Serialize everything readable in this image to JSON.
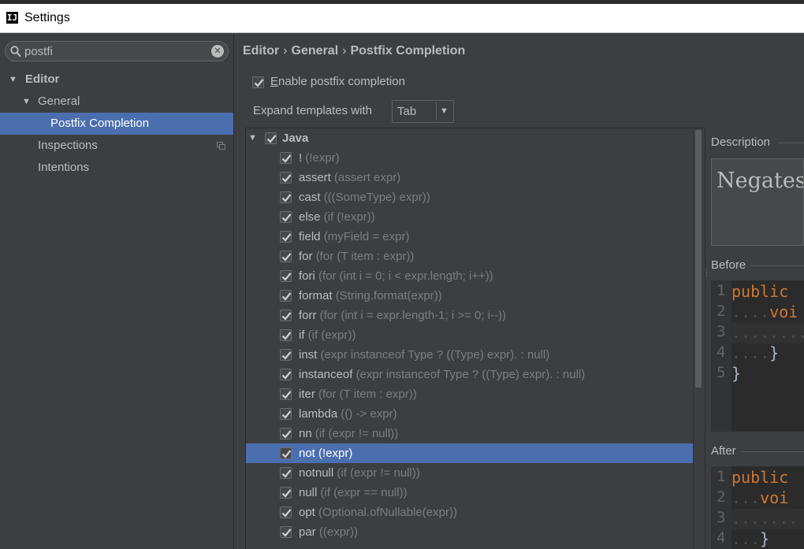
{
  "window": {
    "title": "Settings",
    "icon": "intellij-icon"
  },
  "search": {
    "value": "postfi"
  },
  "tree": [
    {
      "label": "Editor",
      "bold": true,
      "expanded": true
    },
    {
      "label": "General",
      "expanded": true
    },
    {
      "label": "Postfix Completion",
      "selected": true
    },
    {
      "label": "Inspections",
      "has_copy_icon": true
    },
    {
      "label": "Intentions"
    }
  ],
  "breadcrumb": [
    "Editor",
    "General",
    "Postfix Completion"
  ],
  "enable": {
    "label_mnemonic": "E",
    "label_rest": "nable postfix completion",
    "checked": true
  },
  "expand": {
    "label": "Expand templates with",
    "value": "Tab"
  },
  "templates": {
    "group": "Java",
    "items": [
      {
        "key": "!",
        "example": "(!expr)"
      },
      {
        "key": "assert",
        "example": "(assert expr)"
      },
      {
        "key": "cast",
        "example": "(((SomeType) expr))"
      },
      {
        "key": "else",
        "example": "(if (!expr))"
      },
      {
        "key": "field",
        "example": "(myField = expr)"
      },
      {
        "key": "for",
        "example": "(for (T item : expr))"
      },
      {
        "key": "fori",
        "example": "(for (int i = 0; i < expr.length; i++))"
      },
      {
        "key": "format",
        "example": "(String.format(expr))"
      },
      {
        "key": "forr",
        "example": "(for (int i = expr.length-1; i >= 0; i--))"
      },
      {
        "key": "if",
        "example": "(if (expr))"
      },
      {
        "key": "inst",
        "example": "(expr instanceof Type ? ((Type) expr). : null)"
      },
      {
        "key": "instanceof",
        "example": "(expr instanceof Type ? ((Type) expr). : null)"
      },
      {
        "key": "iter",
        "example": "(for (T item : expr))"
      },
      {
        "key": "lambda",
        "example": "(() -> expr)"
      },
      {
        "key": "nn",
        "example": "(if (expr != null))"
      },
      {
        "key": "not",
        "example": "(!expr)",
        "selected": true
      },
      {
        "key": "notnull",
        "example": "(if (expr != null))"
      },
      {
        "key": "null",
        "example": "(if (expr == null))"
      },
      {
        "key": "opt",
        "example": "(Optional.ofNullable(expr))"
      },
      {
        "key": "par",
        "example": "((expr))"
      }
    ]
  },
  "description": {
    "title": "Description",
    "text": "Negates be"
  },
  "before": {
    "title": "Before",
    "lines": [
      {
        "n": "1",
        "dots": "",
        "kw": "public",
        "text": ""
      },
      {
        "n": "2",
        "dots": "....",
        "kw": "voi",
        "text": ""
      },
      {
        "n": "3",
        "dots": "........",
        "kw": "",
        "text": ""
      },
      {
        "n": "4",
        "dots": "....",
        "kw": "",
        "text": "}"
      },
      {
        "n": "5",
        "dots": "",
        "kw": "",
        "text": "}"
      }
    ]
  },
  "after": {
    "title": "After",
    "lines": [
      {
        "n": "1",
        "dots": "",
        "kw": "public",
        "text": ""
      },
      {
        "n": "2",
        "dots": "...",
        "kw": "voi",
        "text": ""
      },
      {
        "n": "3",
        "dots": ".......",
        "kw": "",
        "text": ""
      },
      {
        "n": "4",
        "dots": "...",
        "kw": "",
        "text": "}"
      }
    ]
  },
  "colors": {
    "background": "#3c3f41",
    "selection": "#4b6eaf",
    "keyword": "#cc7832",
    "muted": "#7a7e80"
  }
}
